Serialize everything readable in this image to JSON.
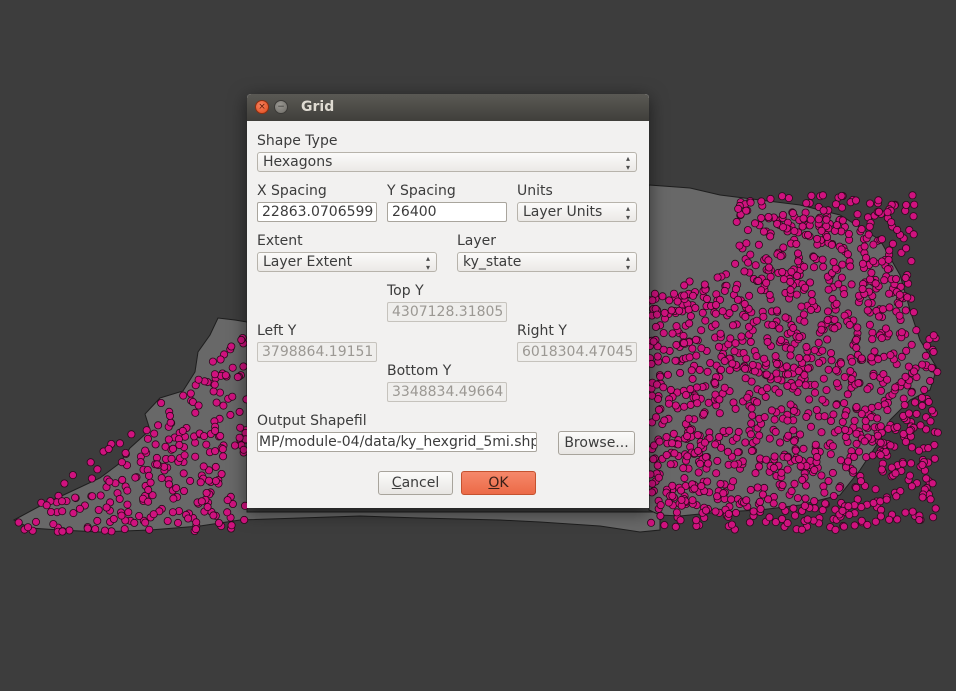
{
  "map": {
    "background_color": "#3d3d3d",
    "polygon_color": "#686868",
    "point_color": "#d0127f",
    "point_outline_color": "#2a0a1a"
  },
  "dialog": {
    "title": "Grid",
    "close_glyph": "×",
    "minimize_glyph": "−",
    "shape_type": {
      "label": "Shape Type",
      "value": "Hexagons"
    },
    "x_spacing": {
      "label": "X Spacing",
      "value": "22863.0706599"
    },
    "y_spacing": {
      "label": "Y Spacing",
      "value": "26400"
    },
    "units": {
      "label": "Units",
      "value": "Layer Units"
    },
    "extent": {
      "label": "Extent",
      "value": "Layer Extent"
    },
    "layer": {
      "label": "Layer",
      "value": "ky_state"
    },
    "top_y": {
      "label": "Top Y",
      "value": "4307128.31805"
    },
    "left_y": {
      "label": "Left Y",
      "value": "3798864.19151"
    },
    "right_y": {
      "label": "Right Y",
      "value": "6018304.47045"
    },
    "bottom_y": {
      "label": "Bottom Y",
      "value": "3348834.49664"
    },
    "output": {
      "label": "Output Shapefil",
      "value": "MP/module-04/data/ky_hexgrid_5mi.shp",
      "browse_label": "Browse..."
    },
    "cancel": {
      "mnemonic": "C",
      "rest": "ancel"
    },
    "ok": {
      "mnemonic": "O",
      "rest": "K"
    },
    "accent_color": "#ec6a47"
  }
}
